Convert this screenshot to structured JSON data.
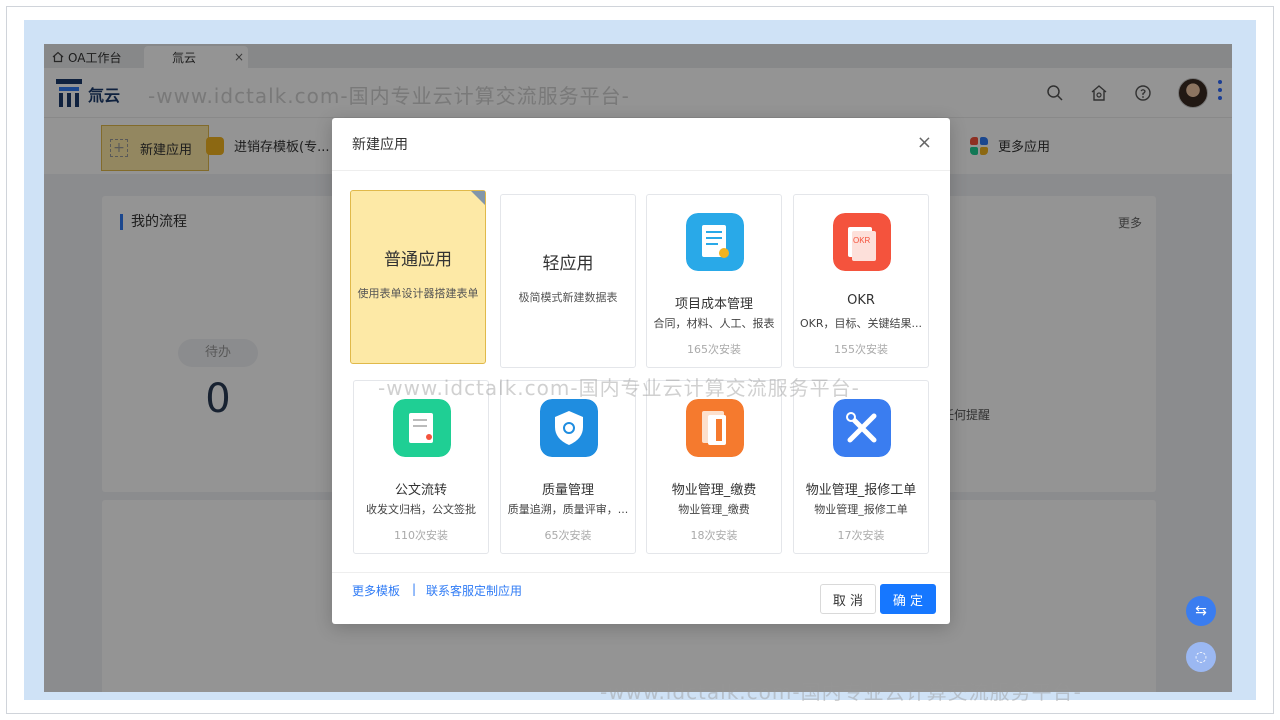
{
  "tabs": [
    {
      "label": "OA工作台"
    },
    {
      "label": "氚云"
    }
  ],
  "header": {
    "logo_text": "氚云",
    "watermark": "-www.idctalk.com-国内专业云计算交流服务平台-"
  },
  "appbar": {
    "new_app": "新建应用",
    "template_item": "进销存模板(专...",
    "more_apps": "更多应用"
  },
  "flow_card": {
    "title": "我的流程",
    "todo_label": "待办",
    "todo_count": "0"
  },
  "right_card": {
    "more": "更多",
    "hint": "任何提醒"
  },
  "dialog": {
    "title": "新建应用",
    "close": "×",
    "normal_app": {
      "title": "普通应用",
      "desc": "使用表单设计器搭建表单"
    },
    "light_app": {
      "title": "轻应用",
      "desc": "极简模式新建数据表"
    },
    "templates": [
      {
        "name": "项目成本管理",
        "desc": "合同，材料、人工、报表",
        "installs": "165次安装",
        "icon": "document-icon",
        "color": "#29a9e8"
      },
      {
        "name": "OKR",
        "desc": "OKR，目标、关键结果...",
        "installs": "155次安装",
        "icon": "okr-icon",
        "color": "#f4533d"
      },
      {
        "name": "公文流转",
        "desc": "收发文归档，公文签批",
        "installs": "110次安装",
        "icon": "file-stamp-icon",
        "color": "#1fcf94"
      },
      {
        "name": "质量管理",
        "desc": "质量追溯，质量评审，...",
        "installs": "65次安装",
        "icon": "shield-icon",
        "color": "#1f8de0"
      },
      {
        "name": "物业管理_缴费",
        "desc": "物业管理_缴费",
        "installs": "18次安装",
        "icon": "ledger-icon",
        "color": "#f57a2e"
      },
      {
        "name": "物业管理_报修工单",
        "desc": "物业管理_报修工单",
        "installs": "17次安装",
        "icon": "tools-icon",
        "color": "#3a7df0"
      }
    ],
    "footer": {
      "more_templates": "更多模板",
      "separator": "|",
      "contact": "联系客服定制应用",
      "cancel": "取 消",
      "ok": "确 定"
    }
  }
}
